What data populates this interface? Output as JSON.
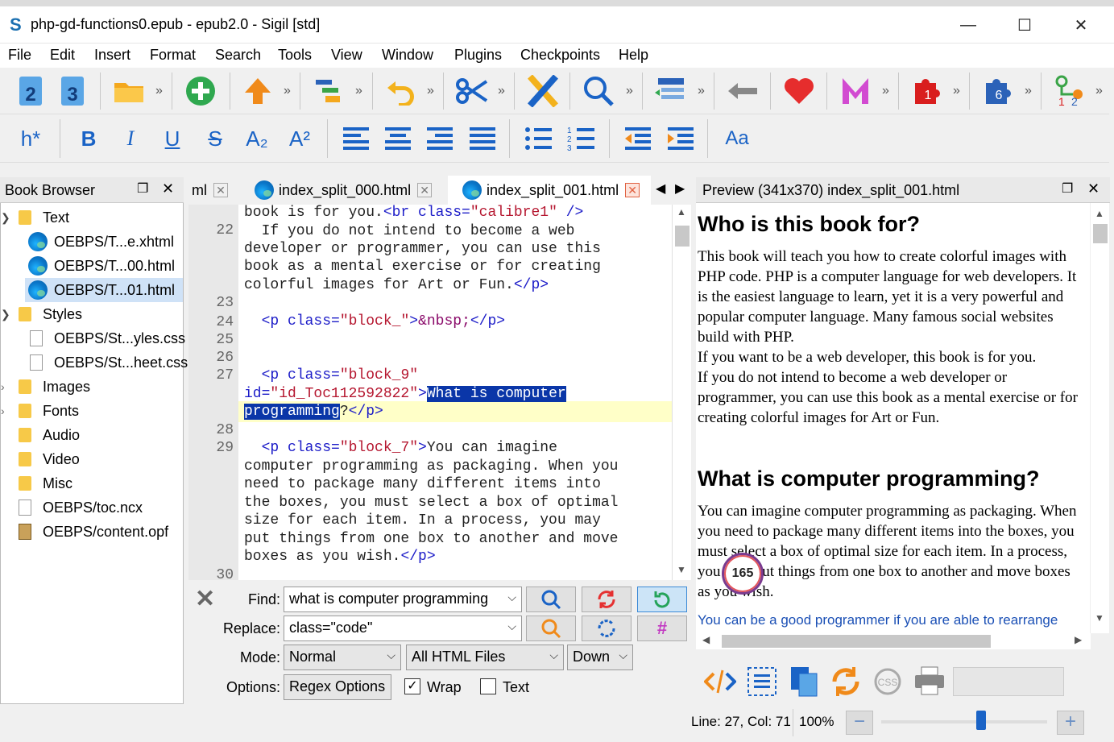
{
  "window": {
    "title": "php-gd-functions0.epub - epub2.0 - Sigil [std]",
    "minimize": "—",
    "maximize": "☐",
    "close": "✕"
  },
  "menu": [
    "File",
    "Edit",
    "Insert",
    "Format",
    "Search",
    "Tools",
    "View",
    "Window",
    "Plugins",
    "Checkpoints",
    "Help"
  ],
  "toolbar1": {
    "heading2": "2",
    "heading3": "3",
    "plugin1_badge": "1",
    "plugin6_badge": "6"
  },
  "toolbar2": {
    "heading": "h*",
    "bold": "B",
    "italic": "I",
    "underline": "U",
    "strike": "S",
    "subscript": "A₂",
    "superscript": "A²",
    "case": "Aa"
  },
  "book_browser": {
    "title": "Book Browser",
    "items": [
      {
        "label": "Text",
        "type": "folder",
        "expanded": true
      },
      {
        "label": "OEBPS/T...e.xhtml",
        "type": "html"
      },
      {
        "label": "OEBPS/T...00.html",
        "type": "html"
      },
      {
        "label": "OEBPS/T...01.html",
        "type": "html",
        "selected": true
      },
      {
        "label": "Styles",
        "type": "folder",
        "expanded": true
      },
      {
        "label": "OEBPS/St...yles.css",
        "type": "css"
      },
      {
        "label": "OEBPS/St...heet.css",
        "type": "css"
      },
      {
        "label": "Images",
        "type": "folder"
      },
      {
        "label": "Fonts",
        "type": "folder"
      },
      {
        "label": "Audio",
        "type": "folder"
      },
      {
        "label": "Video",
        "type": "folder"
      },
      {
        "label": "Misc",
        "type": "folder"
      },
      {
        "label": "OEBPS/toc.ncx",
        "type": "file"
      },
      {
        "label": "OEBPS/content.opf",
        "type": "opf"
      }
    ]
  },
  "tabs": [
    {
      "label": "ml"
    },
    {
      "label": "index_split_000.html"
    },
    {
      "label": "index_split_001.html",
      "active": true
    }
  ],
  "editor": {
    "line_numbers": [
      "22",
      "23",
      "24",
      "25",
      "26",
      "27",
      "28",
      "29",
      "30"
    ],
    "lines": {
      "l0a": "book is for you.",
      "l0b": "<br class=",
      "l0c": "\"calibre1\"",
      "l0d": " />",
      "l1": "  If you do not intend to become a web",
      "l2": "developer or programmer, you can use this",
      "l3": "book as a mental exercise or for creating",
      "l4a": "colorful images for Art or Fun.",
      "l4b": "</p>",
      "l24a": "  <p class=",
      "l24b": "\"block_\"",
      "l24c": ">",
      "l24d": "&nbsp;",
      "l24e": "</p>",
      "l27a": "  <p class=",
      "l27b": "\"block_9\"",
      "l27c": "id=",
      "l27d": "\"id_Toc112592822\"",
      "l27e": ">",
      "l27f": "What is computer",
      "l27g": "programming",
      "l27h": "?",
      "l27i": "</p>",
      "l29a": "  <p class=",
      "l29b": "\"block_7\"",
      "l29c": ">",
      "l29d": "You can imagine",
      "l30": "computer programming as packaging. When you",
      "l31": "need to package many different items into",
      "l32": "the boxes, you must select a box of optimal",
      "l33": "size for each item. In a process, you may",
      "l34": "put things from one box to another and move",
      "l35a": "boxes as you wish.",
      "l35b": "</p>"
    }
  },
  "find": {
    "find_label": "Find:",
    "find_value": "what is computer programming",
    "replace_label": "Replace:",
    "replace_value": "class=\"code\"",
    "mode_label": "Mode:",
    "mode_value": "Normal",
    "scope_value": "All HTML Files",
    "direction_value": "Down",
    "options_label": "Options:",
    "regex_options": "Regex Options",
    "wrap_label": "Wrap",
    "wrap_checked": true,
    "text_label": "Text",
    "text_checked": false
  },
  "preview": {
    "title": "Preview (341x370) index_split_001.html",
    "h1": "Who is this book for?",
    "p1": "This book will teach you how to create colorful images with PHP code. PHP is a computer language for web developers. It is the easiest language to learn, yet it is a very powerful and popular computer language. Many famous social websites build with PHP.",
    "p2": "If you want to be a web developer, this book is for you.",
    "p3": "If you do not intend to become a web developer or programmer, you can use this book as a mental exercise or for creating colorful images for Art or Fun.",
    "h2": "What is computer programming?",
    "p4": "You can imagine computer programming as packaging. When you need to package many different items into the boxes, you must select a box of optimal size for each item. In a process, you may put things from one box to another and move boxes as you wish.",
    "p5": "You can be a good programmer if you are able to rearrange",
    "badge": "165"
  },
  "status": {
    "position": "Line: 27, Col: 71",
    "zoom": "100%",
    "zoom_level": 0.6
  },
  "colors": {
    "selection": "#0a36a8",
    "current_line": "#ffffc8",
    "tag": "#1c1cc8",
    "string": "#b5162f"
  }
}
